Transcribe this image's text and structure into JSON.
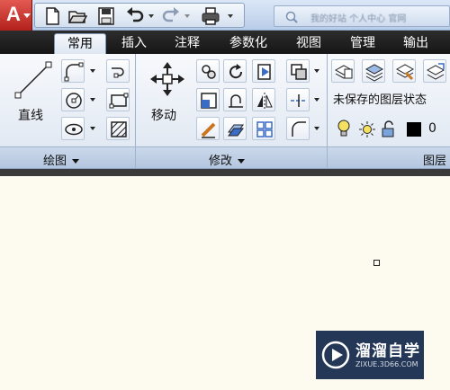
{
  "quick_access": {
    "app_button": "A",
    "icons": [
      "new-icon",
      "open-icon",
      "save-icon",
      "undo-icon",
      "redo-icon",
      "plot-icon"
    ],
    "search_text": "我的好站 个人中心 官网"
  },
  "tabs": [
    {
      "label": "常用",
      "active": true
    },
    {
      "label": "插入",
      "active": false
    },
    {
      "label": "注释",
      "active": false
    },
    {
      "label": "参数化",
      "active": false
    },
    {
      "label": "视图",
      "active": false
    },
    {
      "label": "管理",
      "active": false
    },
    {
      "label": "输出",
      "active": false
    }
  ],
  "panels": {
    "draw": {
      "title": "绘图",
      "line_label": "直线"
    },
    "modify": {
      "title": "修改",
      "move_label": "移动"
    },
    "layers": {
      "title": "图层",
      "layer_state": "未保存的图层状态",
      "current_layer": "0"
    }
  },
  "watermark": {
    "name": "溜溜自学",
    "url": "ZIXUE.3D66.COM"
  },
  "colors": {
    "canvas": "#fdfbef",
    "app_red": "#c8312a",
    "tab_bar": "#1e1e1e",
    "watermark_bg": "#243757"
  }
}
